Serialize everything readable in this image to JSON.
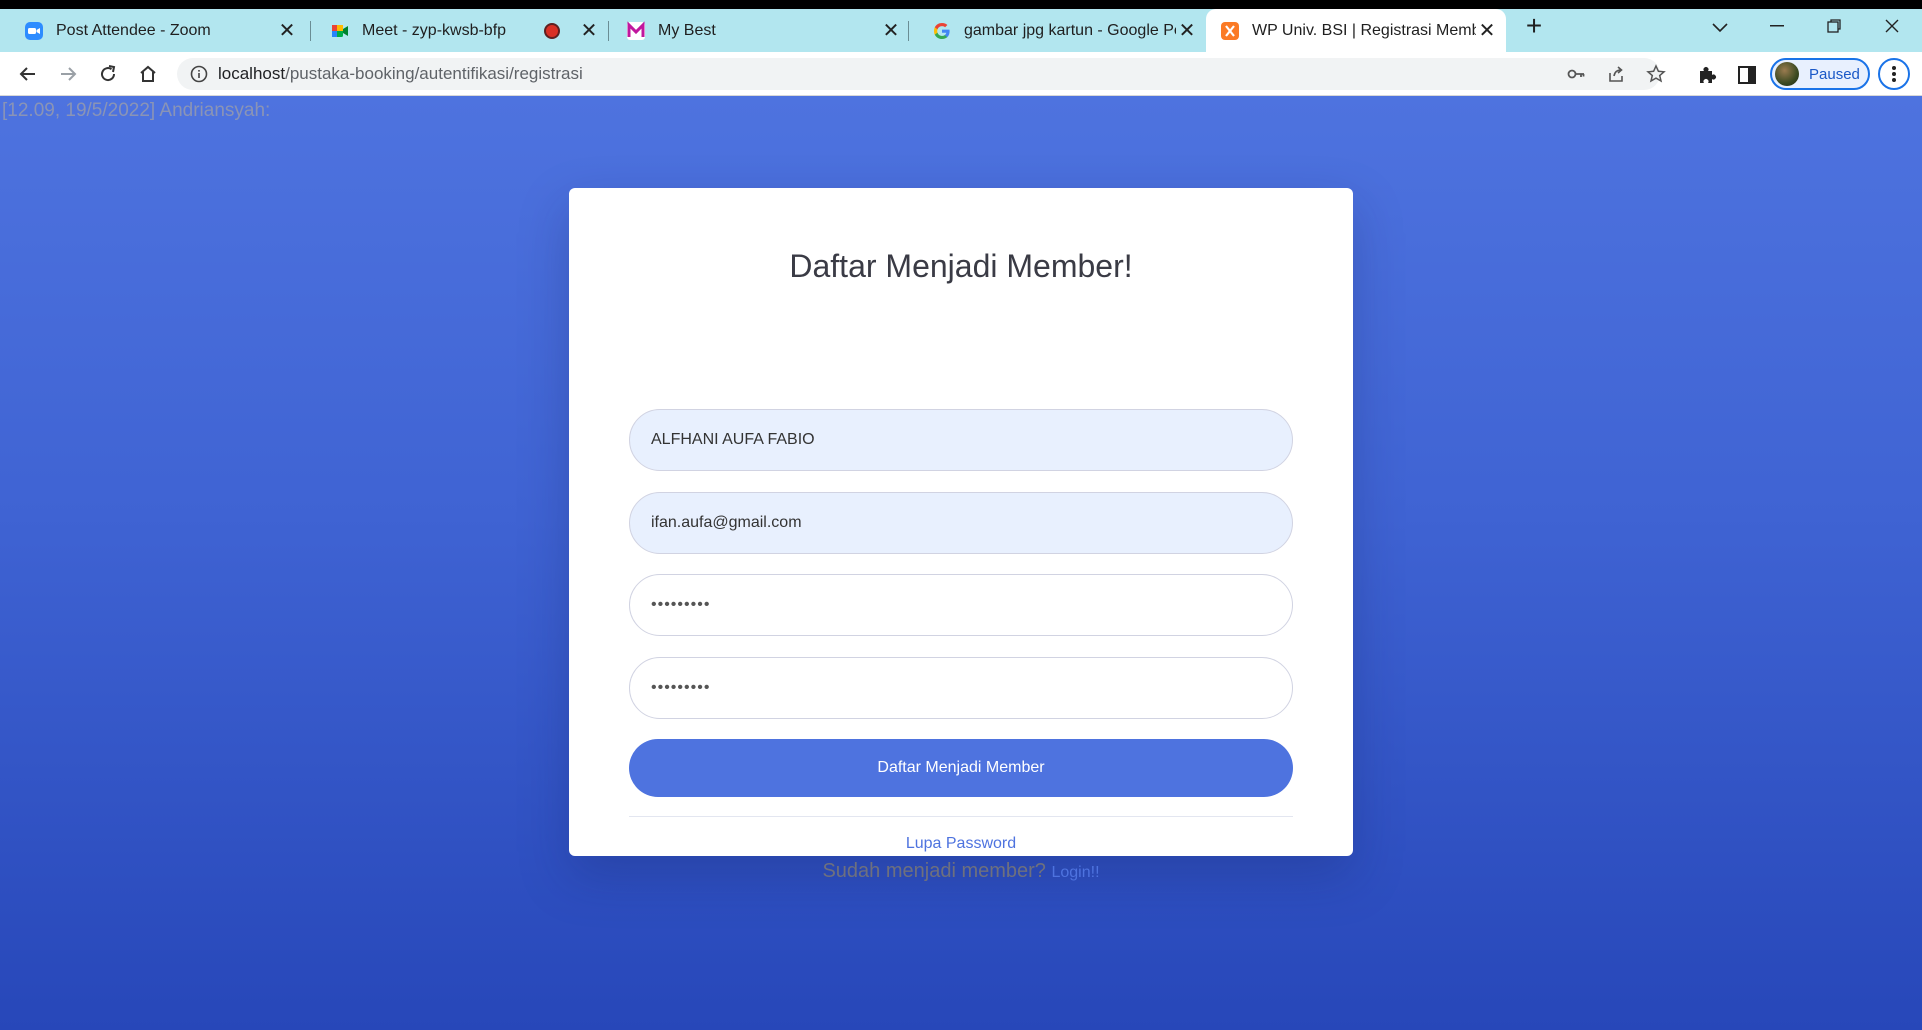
{
  "browser": {
    "tabs": [
      {
        "title": "Post Attendee - Zoom",
        "icon": "zoom-icon"
      },
      {
        "title": "Meet - zyp-kwsb-bfp",
        "icon": "google-meet-icon",
        "recording": true
      },
      {
        "title": "My Best",
        "icon": "mybest-icon"
      },
      {
        "title": "gambar jpg kartun - Google Pene",
        "icon": "google-icon"
      },
      {
        "title": "WP Univ. BSI | Registrasi Member",
        "icon": "xampp-icon",
        "active": true
      }
    ],
    "url_host": "localhost",
    "url_path": "/pustaka-booking/autentifikasi/registrasi",
    "profile_label": "Paused"
  },
  "page": {
    "pasted_text": "[12.09, 19/5/2022] Andriansyah:",
    "title": "Daftar Menjadi Member!",
    "fields": {
      "name_value": "ALFHANI AUFA FABIO",
      "email_value": "ifan.aufa@gmail.com",
      "password_mask": "•••••••••",
      "password_confirm_mask": "•••••••••"
    },
    "submit_label": "Daftar Menjadi Member",
    "forgot_label": "Lupa Password",
    "already_member_text": "Sudah menjadi member?",
    "login_label": "Login!!"
  },
  "colors": {
    "primary": "#4e73df",
    "tabbar": "#b2e6ef"
  }
}
